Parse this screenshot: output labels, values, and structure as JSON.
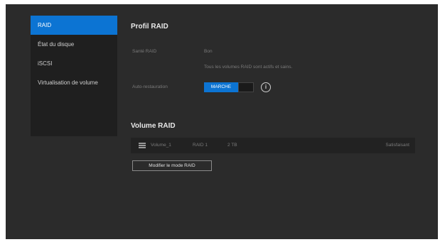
{
  "sidebar": {
    "items": [
      {
        "label": "RAID",
        "active": true
      },
      {
        "label": "État du disque",
        "active": false
      },
      {
        "label": "iSCSI",
        "active": false
      },
      {
        "label": "Virtualisation de volume",
        "active": false
      }
    ]
  },
  "raid_profile": {
    "title": "Profil RAID",
    "health_label": "Santé RAID",
    "health_value": "Bon",
    "health_message": "Tous les volumes RAID sont actifs et sains.",
    "auto_rebuild_label": "Auto-restauration",
    "toggle_on_label": "MARCHE",
    "toggle_state": "on",
    "info_glyph": "i"
  },
  "raid_volume": {
    "title": "Volume RAID",
    "volumes": [
      {
        "name": "Volume_1",
        "raid": "RAID 1",
        "size": "2 TB",
        "status": "Satisfaisant"
      }
    ],
    "modify_button": "Modifier le mode RAID"
  },
  "colors": {
    "accent": "#0c74d3",
    "background": "#2b2b2b",
    "panel": "#1f1f1f"
  }
}
